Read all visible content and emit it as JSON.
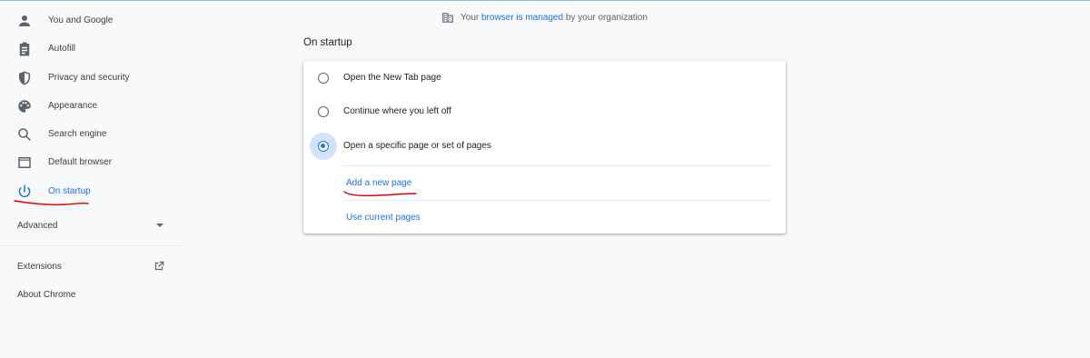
{
  "sidebar": {
    "items": [
      {
        "label": "You and Google",
        "icon": "person-icon"
      },
      {
        "label": "Autofill",
        "icon": "clipboard-icon"
      },
      {
        "label": "Privacy and security",
        "icon": "shield-icon"
      },
      {
        "label": "Appearance",
        "icon": "palette-icon"
      },
      {
        "label": "Search engine",
        "icon": "search-icon"
      },
      {
        "label": "Default browser",
        "icon": "browser-window-icon"
      },
      {
        "label": "On startup",
        "icon": "power-icon",
        "active": true
      }
    ],
    "advanced_label": "Advanced",
    "extensions_label": "Extensions",
    "about_label": "About Chrome"
  },
  "managed": {
    "prefix": "Your",
    "link": "browser is managed",
    "suffix": "by your organization",
    "icon": "building-icon"
  },
  "main": {
    "section_title": "On startup",
    "options": [
      {
        "label": "Open the New Tab page",
        "checked": false
      },
      {
        "label": "Continue where you left off",
        "checked": false
      },
      {
        "label": "Open a specific page or set of pages",
        "checked": true
      }
    ],
    "add_page_label": "Add a new page",
    "use_current_label": "Use current pages"
  },
  "colors": {
    "accent": "#1a73e8",
    "annotation": "#e00000",
    "background": "#f8f9fa"
  }
}
